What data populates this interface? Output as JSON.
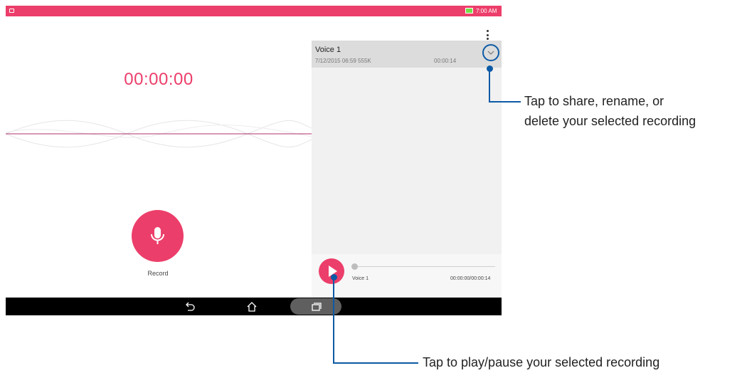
{
  "status_bar": {
    "time": "7:00 AM",
    "accent_color": "#ec3e6a"
  },
  "recorder": {
    "timer": "00:00:00",
    "record_label": "Record"
  },
  "recordings": [
    {
      "title": "Voice 1",
      "meta": "7/12/2015 06:59  555K",
      "duration": "00:00:14"
    }
  ],
  "player": {
    "name": "Voice 1",
    "time": "00:00:00/00:00:14",
    "progress": 0
  },
  "callouts": {
    "menu_line1": "Tap to share, rename, or",
    "menu_line2": "delete your selected recording",
    "play": "Tap to play/pause your selected recording"
  },
  "icons": {
    "overflow": "more-vert-icon",
    "record": "microphone-icon",
    "play": "play-icon",
    "expand": "chevron-down-icon",
    "back": "back-icon",
    "home": "home-icon",
    "recents": "recents-icon"
  }
}
